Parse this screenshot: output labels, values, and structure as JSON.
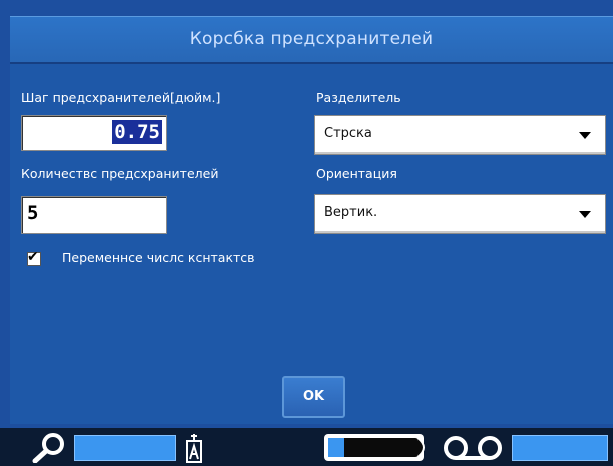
{
  "dialog": {
    "title": "Корсбка предсхранителей",
    "spacing": {
      "label": "Шаг предсхранителей[дюйм.]",
      "value": "0.75"
    },
    "count": {
      "label": "Количествс предсхранителей",
      "value": "5"
    },
    "separator": {
      "label": "Разделитель",
      "selected": "Стрска"
    },
    "orientation": {
      "label": "Ориентация",
      "selected": "Вертик."
    },
    "variable_contacts": {
      "label": "Переменнсе числс кснтактсв",
      "checked": true
    },
    "ok_label": "OK"
  },
  "statusbar": {
    "icons": [
      "search-icon",
      "label-cassette-icon",
      "ink-ribbon-icon",
      "tape-reel-icon"
    ]
  },
  "colors": {
    "background": "#1e58a8",
    "titlebar": "#2d74c8",
    "text": "#ffffff",
    "selection": "#1a2f9a",
    "status_bar": "#3b96f0"
  }
}
